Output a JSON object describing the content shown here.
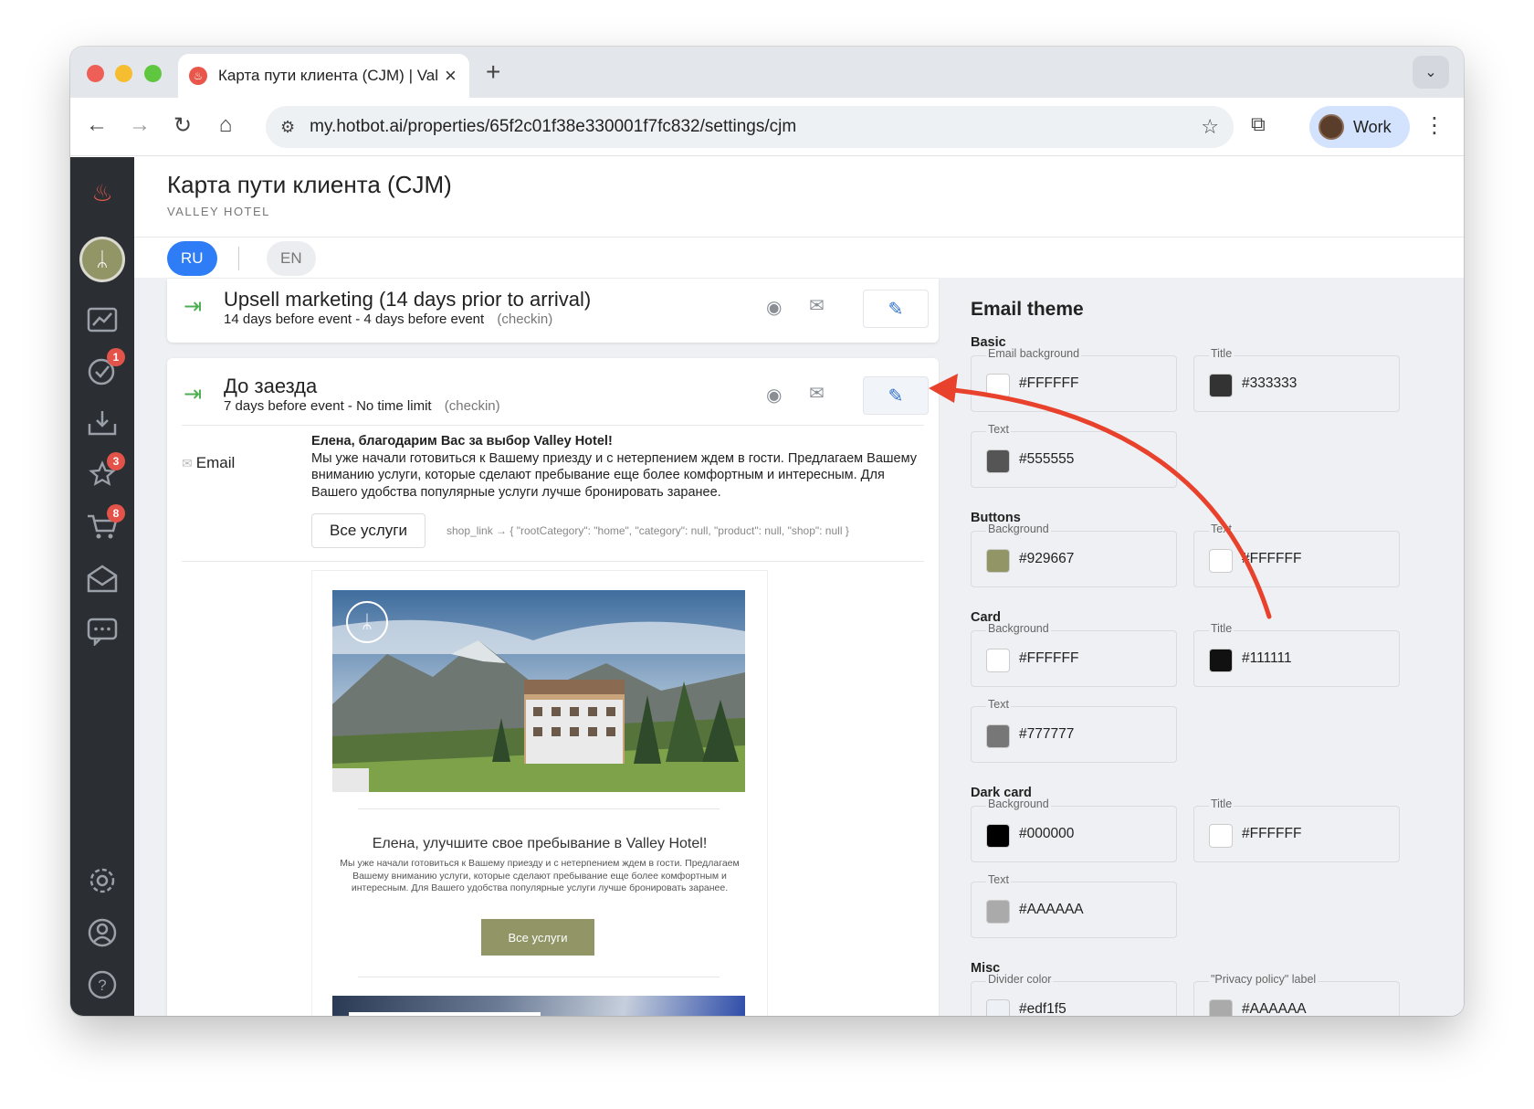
{
  "browser": {
    "tab_title": "Карта пути клиента (CJM) | Valley",
    "tab_close": "×",
    "new_tab": "+",
    "tab_menu": "⌄",
    "url": "my.hotbot.ai/properties/65f2c01f38e330001f7fc832/settings/cjm",
    "profile_label": "Work",
    "back": "←",
    "forward": "→",
    "reload": "↻",
    "home": "⌂",
    "site_info": "⚙",
    "bookmark": "☆",
    "extensions": "⧉",
    "menu": "⋮"
  },
  "sidebar": {
    "badges": {
      "tasks": "1",
      "reviews": "3",
      "cart": "8"
    }
  },
  "header": {
    "title": "Карта пути клиента (CJM)",
    "subtitle": "VALLEY HOTEL"
  },
  "languages": {
    "ru": "RU",
    "en": "EN"
  },
  "steps": [
    {
      "title": "Upsell marketing (14 days prior to arrival)",
      "timing": "14 days before event - 4 days before event",
      "tag": "(checkin)"
    },
    {
      "title": "До заезда",
      "timing": "7 days before event - No time limit",
      "tag": "(checkin)"
    }
  ],
  "email_block": {
    "channel_label": "Email",
    "greeting": "Елена, благодарим Вас за выбор Valley Hotel!",
    "body": "Мы уже начали готовиться к Вашему приезду и с нетерпением ждем в гости. Предлагаем Вашему вниманию услуги, которые сделают пребывание еще более комфортным и интересным. Для Вашего удобства популярные услуги лучше бронировать заранее.",
    "button_label": "Все услуги",
    "shop_link": "shop_link → { \"rootCategory\": \"home\", \"category\": null, \"product\": null, \"shop\": null }"
  },
  "preview": {
    "title": "Елена, улучшите свое пребывание в Valley Hotel!",
    "text": "Мы уже начали готовиться к Вашему приезду и с нетерпением ждем в гости. Предлагаем Вашему вниманию услуги, которые сделают пребывание еще более комфортным и интересным. Для Вашего удобства популярные услуги лучше бронировать заранее.",
    "button_label": "Все услуги"
  },
  "theme": {
    "title": "Email theme",
    "basic": {
      "title": "Basic",
      "email_background": {
        "label": "Email background",
        "value": "#FFFFFF",
        "color": "#FFFFFF"
      },
      "title_color": {
        "label": "Title",
        "value": "#333333",
        "color": "#333333"
      },
      "text": {
        "label": "Text",
        "value": "#555555",
        "color": "#555555"
      }
    },
    "buttons": {
      "title": "Buttons",
      "background": {
        "label": "Background",
        "value": "#929667",
        "color": "#929667"
      },
      "text": {
        "label": "Text",
        "value": "#FFFFFF",
        "color": "#FFFFFF"
      }
    },
    "card": {
      "title": "Card",
      "background": {
        "label": "Background",
        "value": "#FFFFFF",
        "color": "#FFFFFF"
      },
      "title_color": {
        "label": "Title",
        "value": "#111111",
        "color": "#111111"
      },
      "text": {
        "label": "Text",
        "value": "#777777",
        "color": "#777777"
      }
    },
    "dark_card": {
      "title": "Dark card",
      "background": {
        "label": "Background",
        "value": "#000000",
        "color": "#000000"
      },
      "title_color": {
        "label": "Title",
        "value": "#FFFFFF",
        "color": "#FFFFFF"
      },
      "text": {
        "label": "Text",
        "value": "#AAAAAA",
        "color": "#AAAAAA"
      }
    },
    "misc": {
      "title": "Misc",
      "divider": {
        "label": "Divider color",
        "value": "#edf1f5",
        "color": "#edf1f5"
      },
      "privacy": {
        "label": "\"Privacy policy\" label",
        "value": "#AAAAAA",
        "color": "#AAAAAA"
      }
    }
  },
  "annotation": {
    "arrow_color": "#e8412c"
  }
}
